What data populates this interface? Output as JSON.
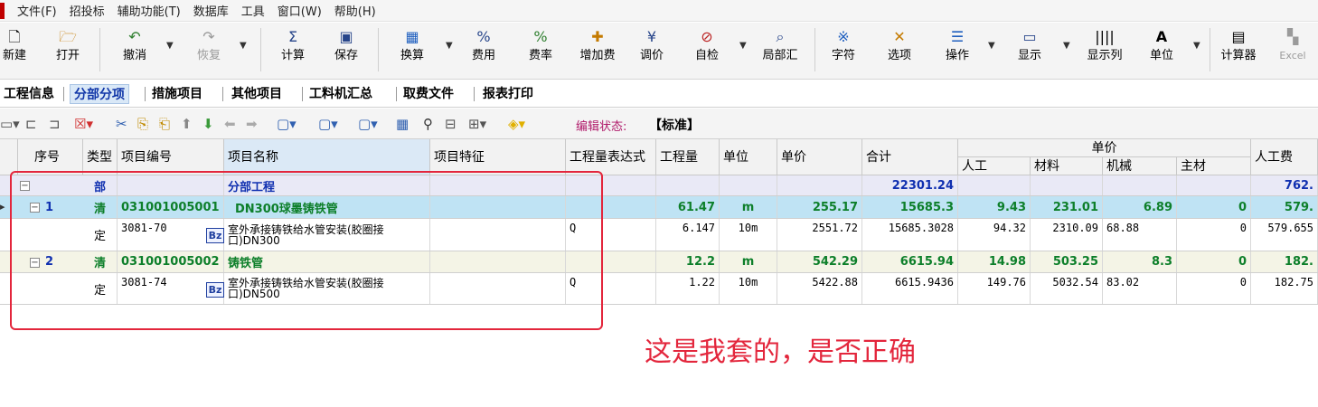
{
  "menu": [
    "文件(F)",
    "招投标",
    "辅助功能(T)",
    "数据库",
    "工具",
    "窗口(W)",
    "帮助(H)"
  ],
  "toolbar": {
    "new": "新建",
    "open": "打开",
    "undo": "撤消",
    "redo": "恢复",
    "calc": "计算",
    "save": "保存",
    "convert": "换算",
    "fee": "费用",
    "rate": "费率",
    "add_fee": "增加费",
    "adjust": "调价",
    "selfcheck": "自检",
    "summary": "局部汇",
    "chars": "字符",
    "options": "选项",
    "operate": "操作",
    "display": "显示",
    "display_cols": "显示列",
    "unit": "单位",
    "calculator": "计算器",
    "excel": "Excel",
    "icon_yen": "¥",
    "icon_unit": "A"
  },
  "tabs": [
    "工程信息",
    "分部分项",
    "措施项目",
    "其他项目",
    "工料机汇总",
    "取费文件",
    "报表打印"
  ],
  "active_tab": "分部分项",
  "edit_state": {
    "label": "编辑状态:",
    "value": "【标准】"
  },
  "grid": {
    "headers": {
      "seq": "序号",
      "type": "类型",
      "code": "项目编号",
      "name": "项目名称",
      "feature": "项目特征",
      "expr": "工程量表达式",
      "qty": "工程量",
      "unit": "单位",
      "price": "单价",
      "total": "合计",
      "unit_price_group": "单价",
      "labor": "人工",
      "material": "材料",
      "machine": "机械",
      "main_mat": "主材",
      "labor_fee": "人工费"
    },
    "rows": [
      {
        "kind": "bu",
        "seq": "",
        "type": "部",
        "code": "",
        "name": "分部工程",
        "feature": "",
        "expr": "",
        "qty": "",
        "unit": "",
        "price": "",
        "total": "22301.24",
        "labor": "",
        "material": "",
        "machine": "",
        "main_mat": "",
        "labor_fee": "762."
      },
      {
        "kind": "qing",
        "seq": "1",
        "type": "清",
        "code": "031001005001",
        "name": "DN300球墨铸铁管",
        "feature": "",
        "expr": "",
        "qty": "61.47",
        "unit": "m",
        "price": "255.17",
        "total": "15685.3",
        "labor": "9.43",
        "material": "231.01",
        "machine": "6.89",
        "main_mat": "0",
        "labor_fee": "579."
      },
      {
        "kind": "ding",
        "seq": "",
        "type": "定",
        "code": "3081-70",
        "name": "室外承接铸铁给水管安装(胶圈接口)DN300",
        "feature": "",
        "expr": "Q",
        "qty": "6.147",
        "unit": "10m",
        "price": "2551.72",
        "total": "15685.3028",
        "labor": "94.32",
        "material": "2310.09",
        "machine": "68.88",
        "main_mat": "0",
        "labor_fee": "579.655"
      },
      {
        "kind": "qing",
        "seq": "2",
        "type": "清",
        "code": "031001005002",
        "name": "铸铁管",
        "feature": "",
        "expr": "",
        "qty": "12.2",
        "unit": "m",
        "price": "542.29",
        "total": "6615.94",
        "labor": "14.98",
        "material": "503.25",
        "machine": "8.3",
        "main_mat": "0",
        "labor_fee": "182."
      },
      {
        "kind": "ding",
        "seq": "",
        "type": "定",
        "code": "3081-74",
        "name": "室外承接铸铁给水管安装(胶圈接口)DN500",
        "feature": "",
        "expr": "Q",
        "qty": "1.22",
        "unit": "10m",
        "price": "5422.88",
        "total": "6615.9436",
        "labor": "149.76",
        "material": "5032.54",
        "machine": "83.02",
        "main_mat": "0",
        "labor_fee": "182.75"
      }
    ]
  },
  "annotation": "这是我套的，是否正确",
  "colors": {
    "annotation_red": "#e3263c",
    "active_tab": "#1036a8",
    "selected_row": "#bfe3f4"
  }
}
